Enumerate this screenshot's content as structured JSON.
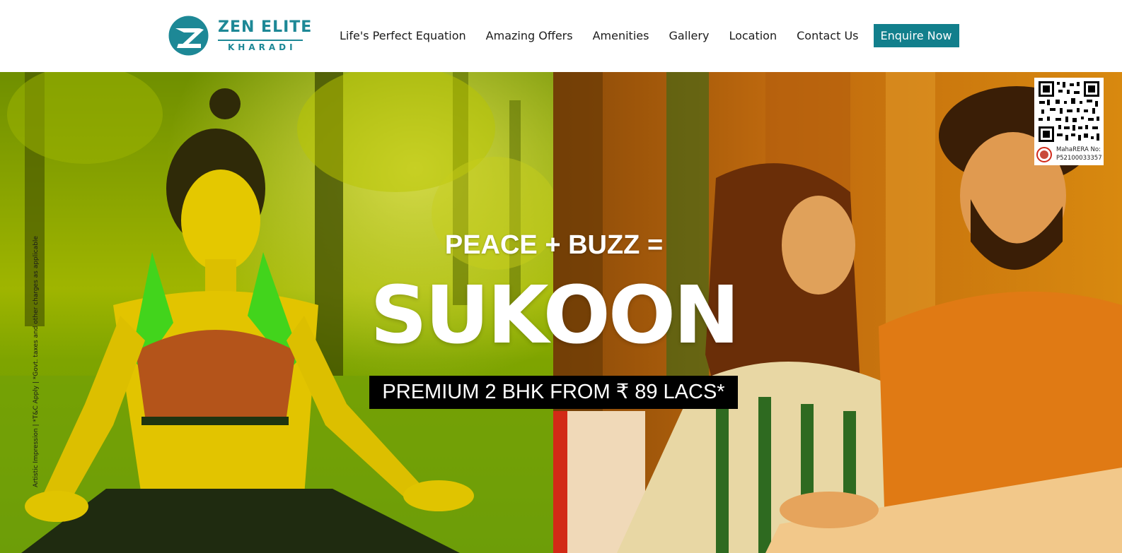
{
  "brand": {
    "name": "ZEN ELITE",
    "location": "KHARADI",
    "color": "#1d8896"
  },
  "nav": {
    "items": [
      {
        "label": "Life's Perfect Equation"
      },
      {
        "label": "Amazing Offers"
      },
      {
        "label": "Amenities"
      },
      {
        "label": "Gallery"
      },
      {
        "label": "Location"
      },
      {
        "label": "Contact Us"
      }
    ],
    "cta_label": "Enquire Now",
    "cta_color": "#127f8c"
  },
  "hero": {
    "tagline": "PEACE + BUZZ =",
    "headline": "SUKOON",
    "price": "PREMIUM 2 BHK FROM ₹ 89 LACS*",
    "disclaimer": "Artistic Impression | *T&C Apply | *Govt. taxes and other charges as applicable",
    "left_tint": "#c8d400",
    "right_tint": "#e8780a"
  },
  "rera": {
    "label": "MahaRERA No:",
    "number": "P52100033357"
  }
}
